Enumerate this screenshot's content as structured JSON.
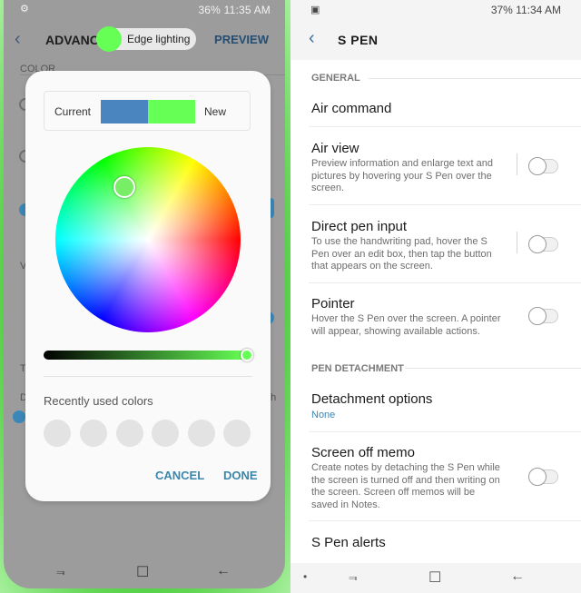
{
  "left": {
    "status": {
      "left_icon": "⚙",
      "right": "36% 11:35 AM"
    },
    "header": {
      "title": "ADVANCE",
      "preview": "PREVIEW"
    },
    "toast": {
      "label": "Edge lighting"
    },
    "background": {
      "section": "COLOR",
      "item_v": "V",
      "item_t": "T",
      "item_d": "D",
      "item_gh": "gh"
    },
    "dialog": {
      "current_label": "Current",
      "new_label": "New",
      "current_color": "#4a85c0",
      "new_color": "#66ff55",
      "recent_label": "Recently used colors",
      "recent_slots": 6,
      "cancel": "CANCEL",
      "done": "DONE"
    },
    "nav": {
      "recents": "⫬",
      "home": "☐",
      "back": "←"
    }
  },
  "right": {
    "status": {
      "left_icon": "▣",
      "right": "37% 11:34 AM"
    },
    "header": {
      "title": "S PEN",
      "back": "‹"
    },
    "sections": {
      "general": "GENERAL",
      "detachment": "PEN DETACHMENT"
    },
    "rows": {
      "air_command": {
        "title": "Air command"
      },
      "air_view": {
        "title": "Air view",
        "desc": "Preview information and enlarge text and pictures by hovering your S Pen over the screen.",
        "enabled": false
      },
      "direct_pen": {
        "title": "Direct pen input",
        "desc": "To use the handwriting pad, hover the S Pen over an edit box, then tap the button that appears on the screen.",
        "enabled": false
      },
      "pointer": {
        "title": "Pointer",
        "desc": "Hover the S Pen over the screen. A pointer will appear, showing available actions.",
        "enabled": false
      },
      "detachment_options": {
        "title": "Detachment options",
        "value": "None"
      },
      "screen_off_memo": {
        "title": "Screen off memo",
        "desc": "Create notes by detaching the S Pen while the screen is turned off and then writing on the screen. Screen off memos will be saved in Notes.",
        "enabled": false
      },
      "s_pen_alerts": {
        "title": "S Pen alerts"
      }
    },
    "nav": {
      "dot": "•",
      "recents": "⫬",
      "home": "☐",
      "back": "←"
    }
  },
  "colors": {
    "accent": "#3a86ad",
    "toast_dot": "#66ff55",
    "edge_glow": "#4fd33c"
  }
}
